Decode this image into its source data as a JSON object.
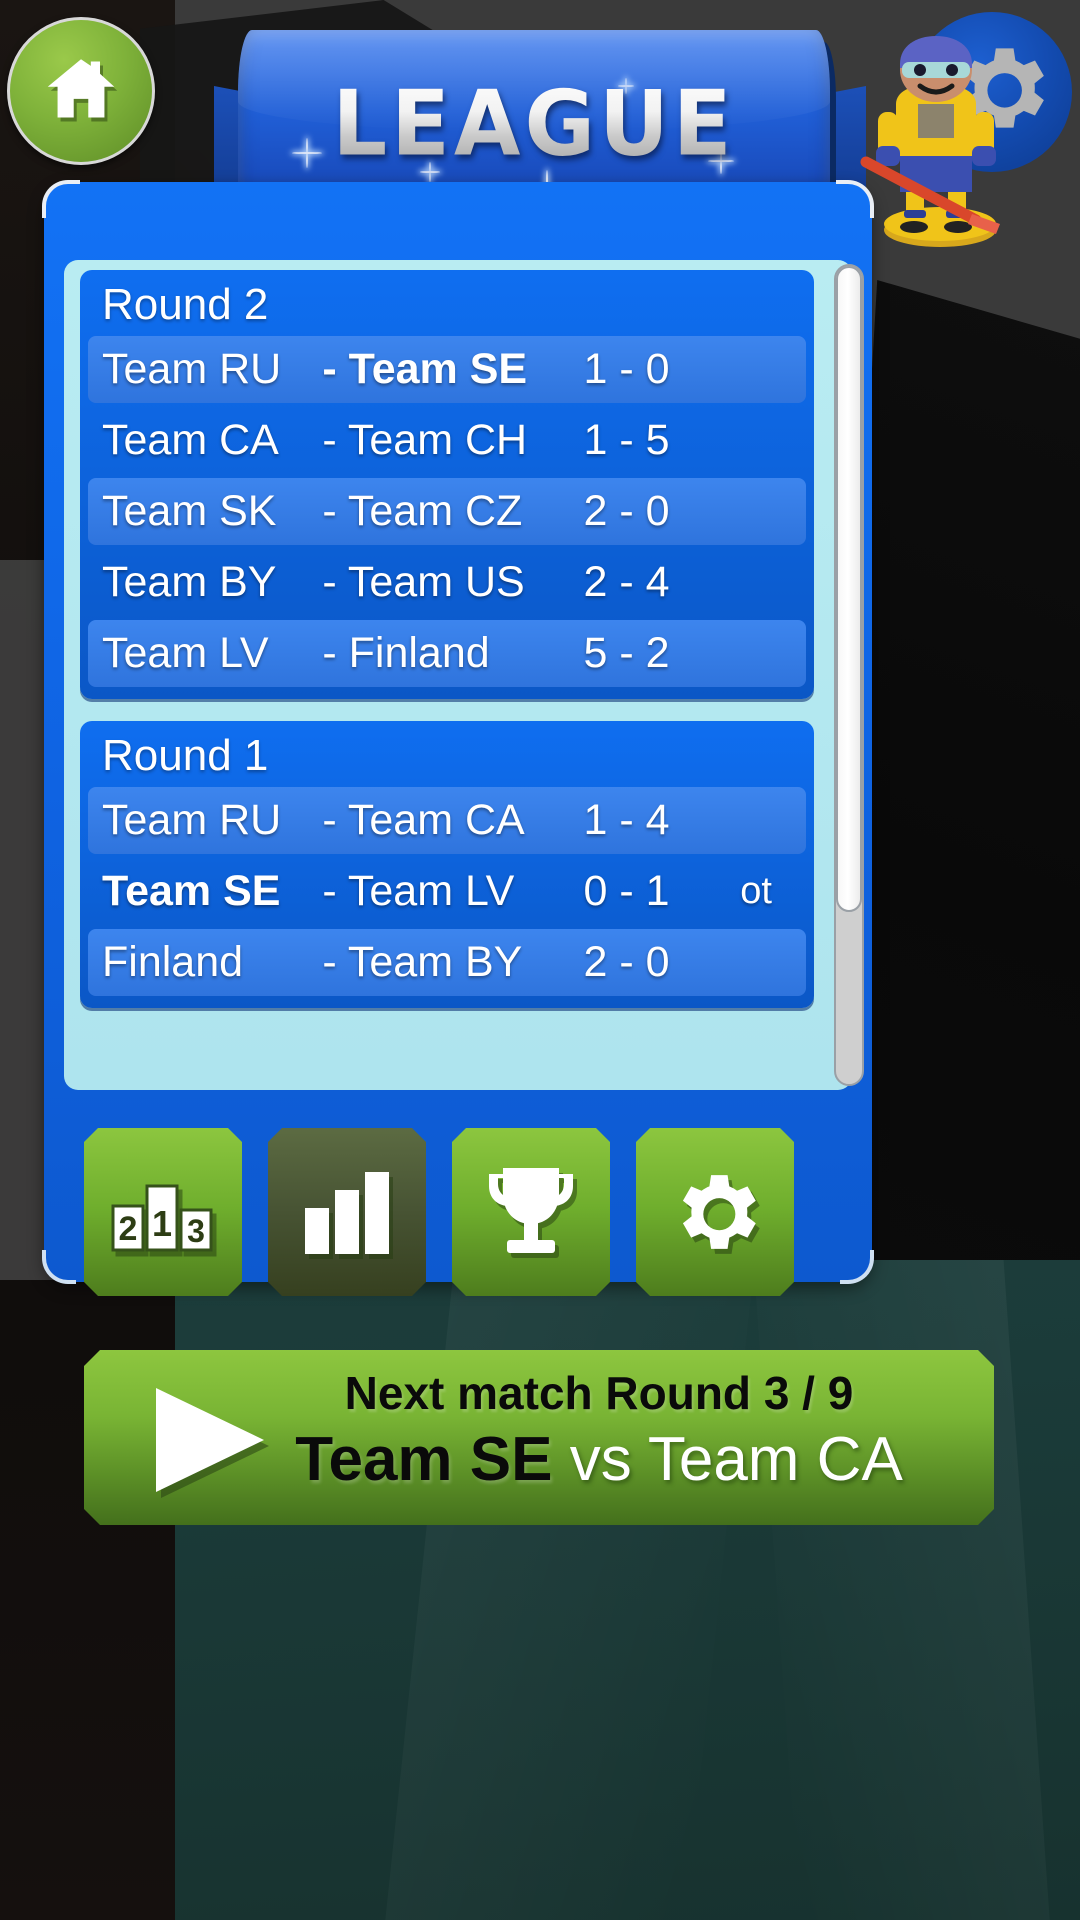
{
  "header": {
    "title": "LEAGUE",
    "home_button_label": "Home",
    "home_icon": "home-icon",
    "settings_icon": "gear-icon",
    "avatar_icon": "hockey-player-avatar"
  },
  "scroll": {
    "thumb_position_percent": 0,
    "thumb_size_percent": 79
  },
  "rounds": [
    {
      "title": "Round 2",
      "matches": [
        {
          "home": "Team RU",
          "away": "Team SE",
          "score": "1 - 0",
          "flag": "",
          "home_bold": false,
          "away_bold": true
        },
        {
          "home": "Team CA",
          "away": "Team CH",
          "score": "1 - 5",
          "flag": "",
          "home_bold": false,
          "away_bold": false
        },
        {
          "home": "Team SK",
          "away": "Team CZ",
          "score": "2 - 0",
          "flag": "",
          "home_bold": false,
          "away_bold": false
        },
        {
          "home": "Team BY",
          "away": "Team US",
          "score": "2 - 4",
          "flag": "",
          "home_bold": false,
          "away_bold": false
        },
        {
          "home": "Team LV",
          "away": "Finland",
          "score": "5 - 2",
          "flag": "",
          "home_bold": false,
          "away_bold": false
        }
      ]
    },
    {
      "title": "Round 1",
      "matches": [
        {
          "home": "Team RU",
          "away": "Team CA",
          "score": "1 - 4",
          "flag": "",
          "home_bold": false,
          "away_bold": false
        },
        {
          "home": "Team SE",
          "away": "Team LV",
          "score": "0 - 1",
          "flag": "ot",
          "home_bold": true,
          "away_bold": false
        },
        {
          "home": "Finland",
          "away": "Team BY",
          "score": "2 - 0",
          "flag": "",
          "home_bold": false,
          "away_bold": false
        }
      ]
    }
  ],
  "toolbar": [
    {
      "name": "standings-button",
      "icon": "podium-icon",
      "active": false,
      "podium_labels": [
        "2",
        "1",
        "3"
      ]
    },
    {
      "name": "statistics-button",
      "icon": "bar-chart-icon",
      "active": true
    },
    {
      "name": "trophy-button",
      "icon": "trophy-icon",
      "active": false
    },
    {
      "name": "settings-button",
      "icon": "gear-icon",
      "active": false
    }
  ],
  "next_match": {
    "heading": "Next match Round 3 / 9",
    "own_team": "Team SE",
    "versus": " vs Team CA",
    "play_icon": "play-triangle-icon"
  },
  "colors": {
    "panel_blue": "#0f63e2",
    "frame_cyan": "#aee4ee",
    "row_light": "#3d85ee",
    "accent_green": "#8cc63f",
    "active_tab": "#485434"
  }
}
